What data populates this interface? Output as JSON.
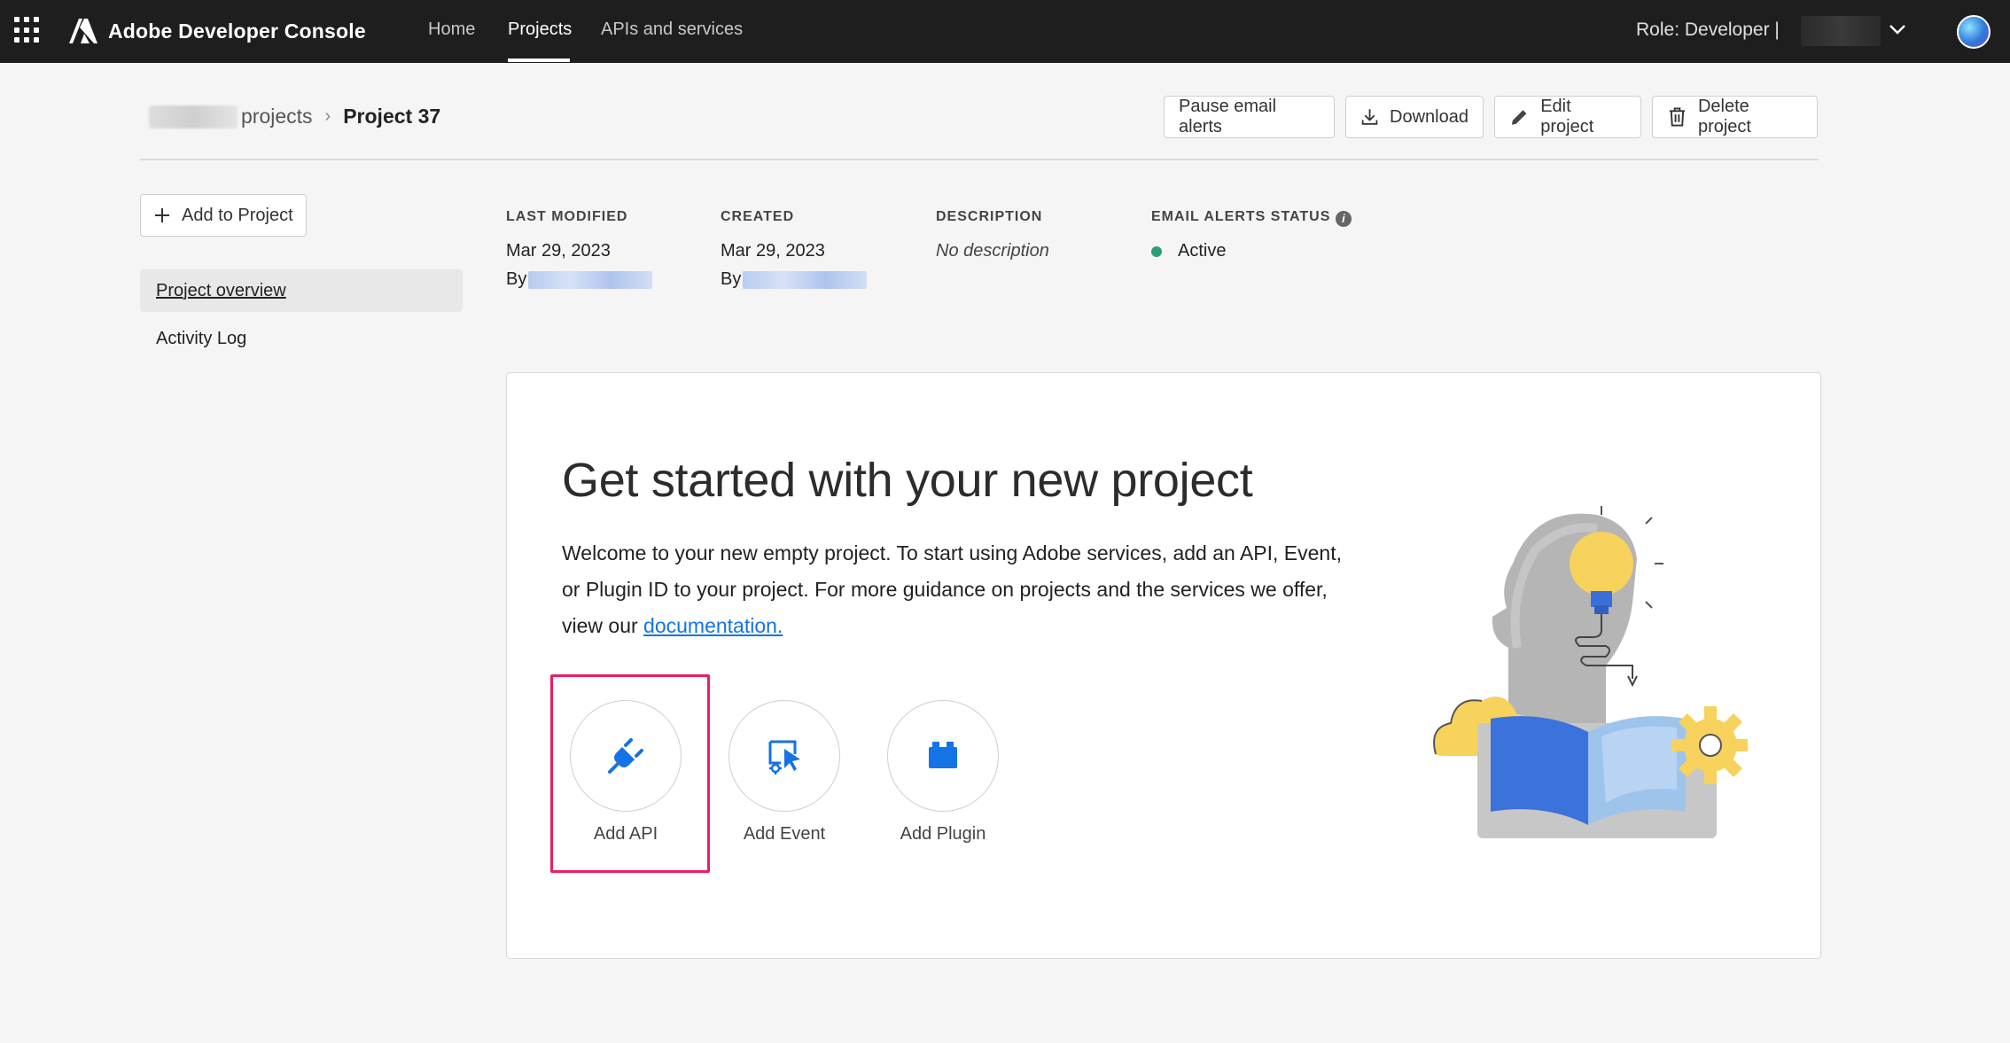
{
  "topbar": {
    "brand": "Adobe Developer Console",
    "nav": [
      {
        "label": "Home"
      },
      {
        "label": "Projects"
      },
      {
        "label": "APIs and services"
      }
    ],
    "role": "Role: Developer   |"
  },
  "breadcrumb": {
    "parent": "projects",
    "current": "Project 37"
  },
  "header_actions": {
    "pause": "Pause email alerts",
    "download": "Download",
    "edit": "Edit project",
    "delete": "Delete project"
  },
  "sidebar": {
    "add_label": "Add to Project",
    "items": [
      {
        "label": "Project overview"
      },
      {
        "label": "Activity Log"
      }
    ]
  },
  "meta": {
    "last_modified": {
      "label": "LAST MODIFIED",
      "date": "Mar 29, 2023",
      "by": "By"
    },
    "created": {
      "label": "CREATED",
      "date": "Mar 29, 2023",
      "by": "By"
    },
    "description": {
      "label": "DESCRIPTION",
      "value": "No description"
    },
    "email_alerts": {
      "label": "EMAIL ALERTS STATUS",
      "value": "Active"
    }
  },
  "card": {
    "title": "Get started with your new project",
    "text": "Welcome to your new empty project. To start using Adobe services, add an API, Event, or Plugin ID to your project. For more guidance on projects and the services we offer, view our",
    "link": "documentation.",
    "actions": [
      {
        "label": "Add API",
        "icon": "plug-icon"
      },
      {
        "label": "Add Event",
        "icon": "event-icon"
      },
      {
        "label": "Add Plugin",
        "icon": "plugin-icon"
      }
    ]
  },
  "colors": {
    "accent_blue": "#1473e6",
    "highlight": "#e91e63",
    "status_green": "#2d9d78"
  }
}
